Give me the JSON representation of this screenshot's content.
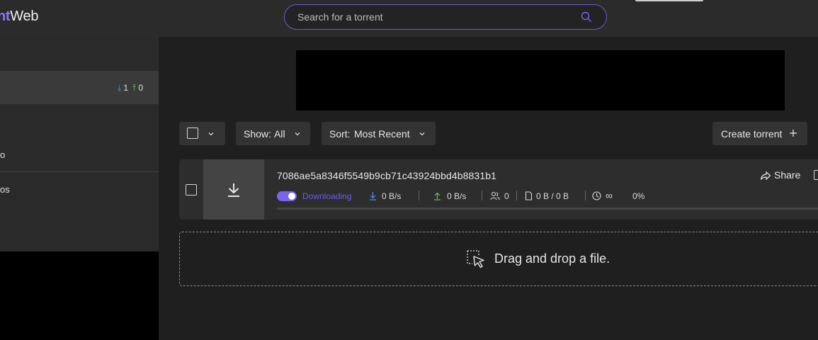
{
  "app": {
    "brand_accent": "nt",
    "brand_plain": "Web"
  },
  "search": {
    "placeholder": "Search for a torrent",
    "icon": "search-icon"
  },
  "sidebar": {
    "active_item": {
      "download_count": "1",
      "upload_count": "0"
    },
    "label_1": "o",
    "label_2": "os"
  },
  "toolbar": {
    "show_label": "Show:",
    "show_value": "All",
    "sort_label": "Sort:",
    "sort_value": "Most Recent",
    "create_label": "Create torrent"
  },
  "torrents": [
    {
      "name": "7086ae5a8346f5549b9cb71c43924bbd4b8831b1",
      "status": "Downloading",
      "download_speed": "0 B/s",
      "upload_speed": "0 B/s",
      "peers": "0",
      "size": "0 B / 0 B",
      "eta": "∞",
      "progress_text": "0%",
      "progress": 0,
      "share_label": "Share"
    }
  ],
  "dropzone": {
    "text": "Drag and drop a file."
  },
  "colors": {
    "accent": "#7b62f0",
    "download": "#4a8fff",
    "upload": "#5ec94b"
  }
}
